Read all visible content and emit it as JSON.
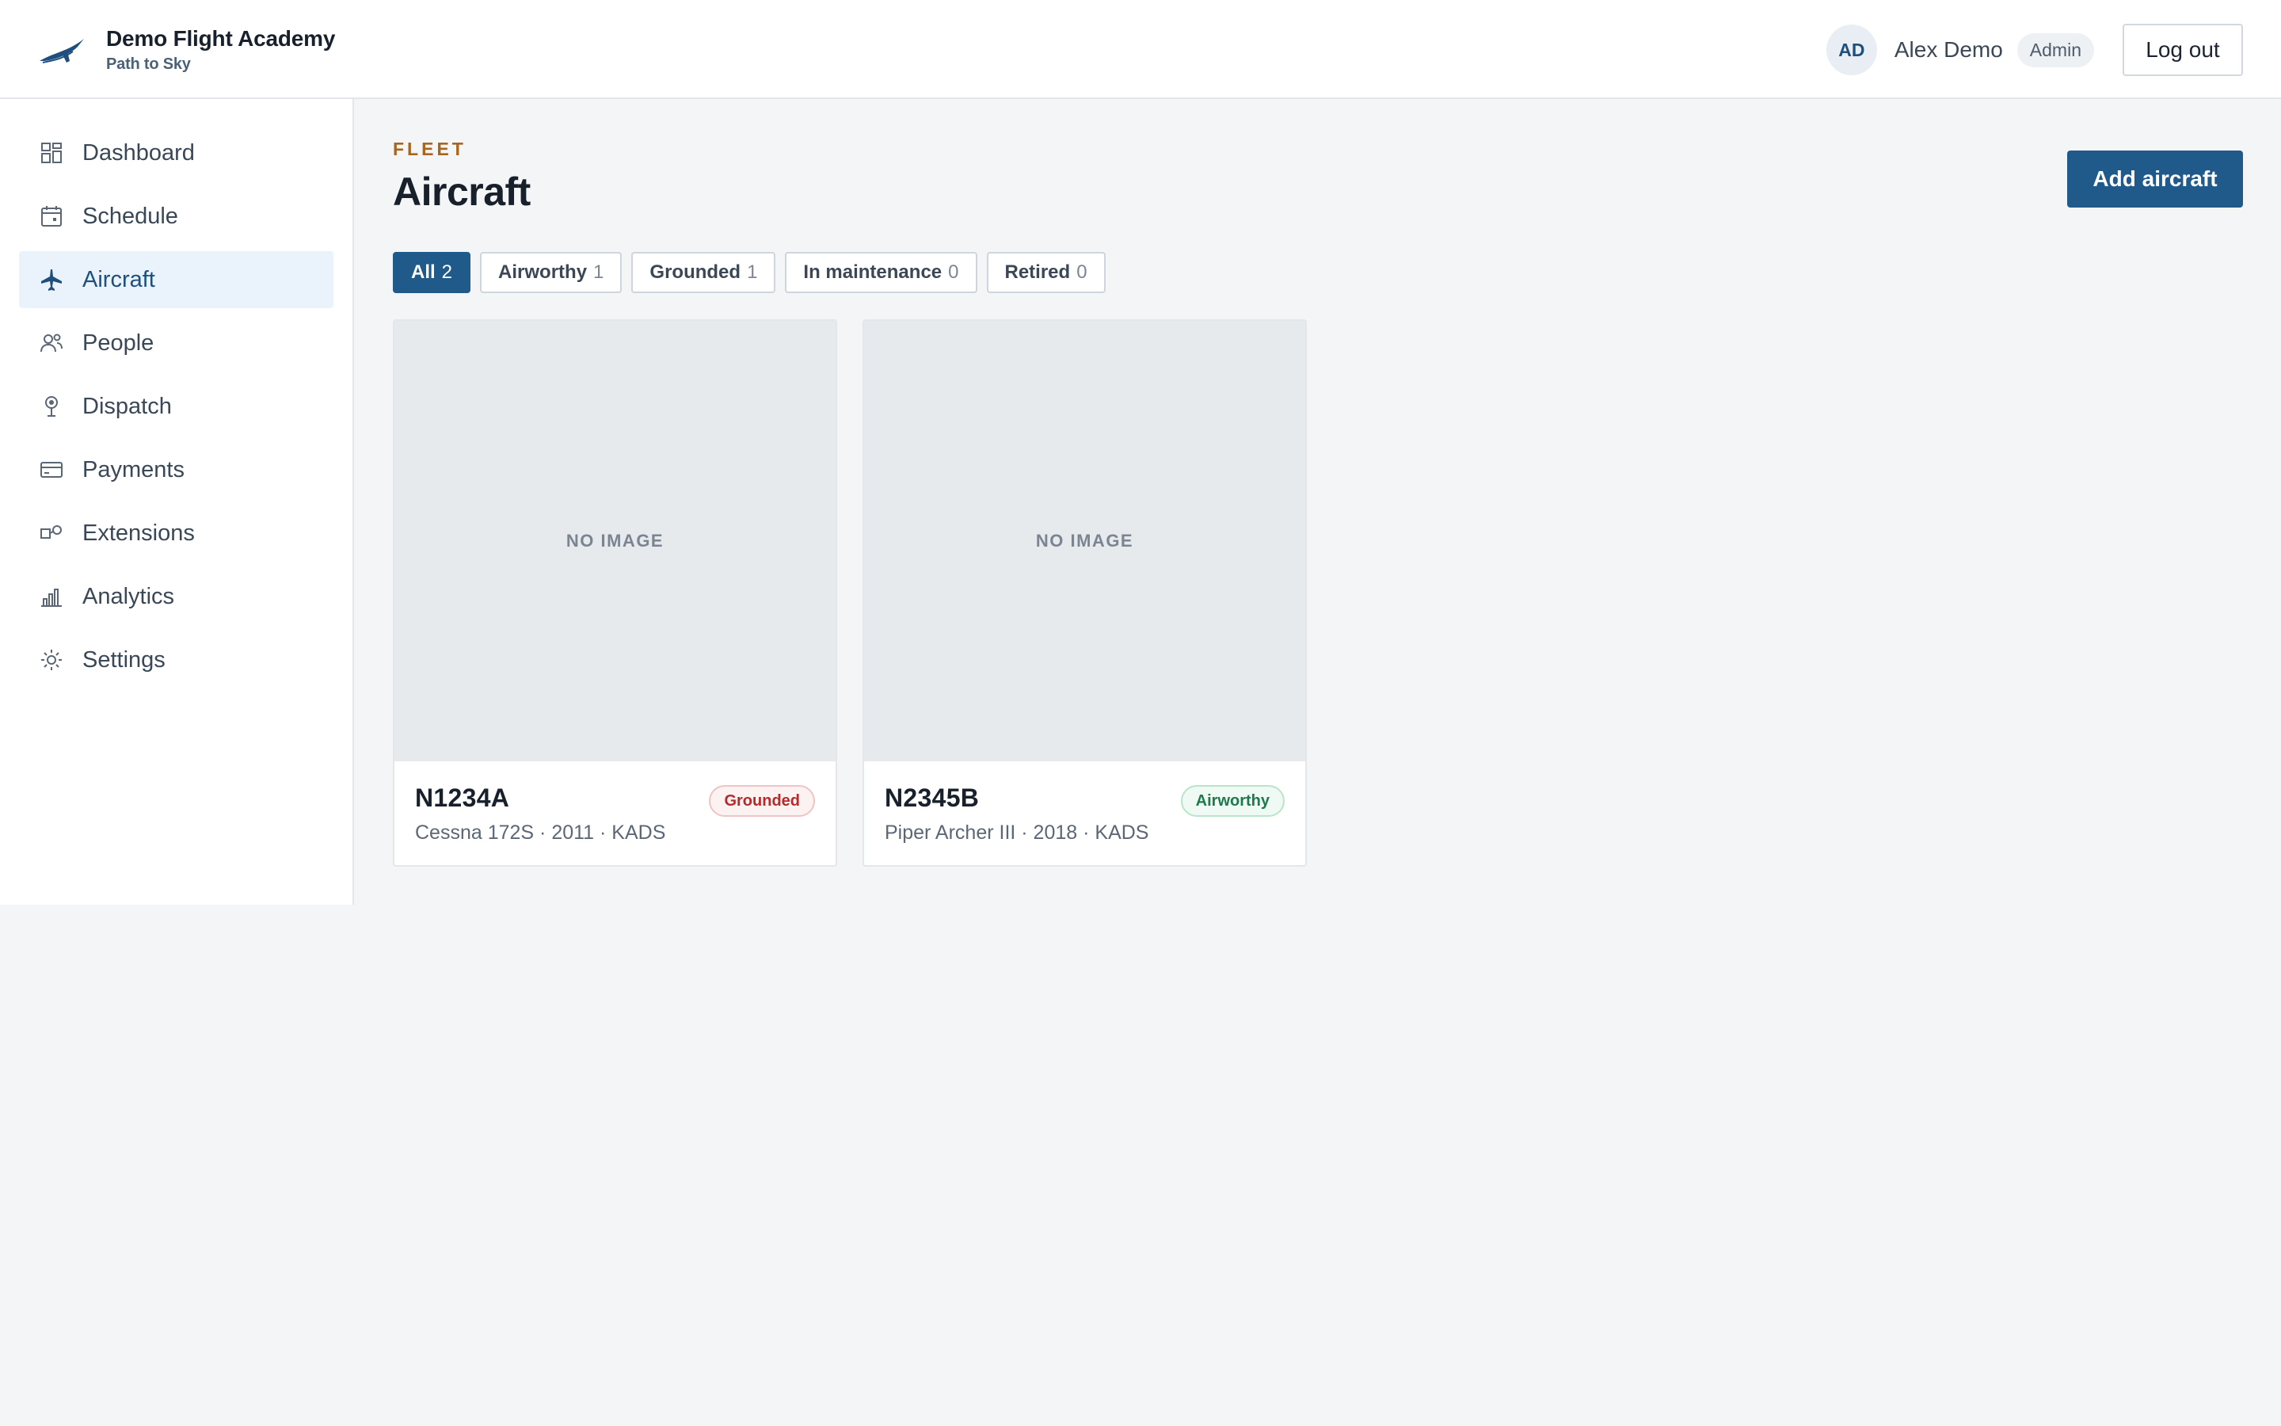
{
  "brand": {
    "name": "Demo Flight Academy",
    "tagline": "Path to Sky",
    "logo_icon": "plane-swoosh-logo"
  },
  "user": {
    "initials": "AD",
    "name": "Alex Demo",
    "role": "Admin",
    "logout_label": "Log out"
  },
  "sidebar": {
    "items": [
      {
        "label": "Dashboard",
        "icon": "dashboard-icon",
        "active": false
      },
      {
        "label": "Schedule",
        "icon": "calendar-icon",
        "active": false
      },
      {
        "label": "Aircraft",
        "icon": "airplane-icon",
        "active": true
      },
      {
        "label": "People",
        "icon": "people-icon",
        "active": false
      },
      {
        "label": "Dispatch",
        "icon": "dispatch-icon",
        "active": false
      },
      {
        "label": "Payments",
        "icon": "credit-card-icon",
        "active": false
      },
      {
        "label": "Extensions",
        "icon": "extensions-icon",
        "active": false
      },
      {
        "label": "Analytics",
        "icon": "analytics-icon",
        "active": false
      },
      {
        "label": "Settings",
        "icon": "settings-icon",
        "active": false
      }
    ]
  },
  "page": {
    "eyebrow": "FLEET",
    "title": "Aircraft",
    "add_button_label": "Add aircraft"
  },
  "filters": [
    {
      "label": "All",
      "count": "2",
      "active": true
    },
    {
      "label": "Airworthy",
      "count": "1",
      "active": false
    },
    {
      "label": "Grounded",
      "count": "1",
      "active": false
    },
    {
      "label": "In maintenance",
      "count": "0",
      "active": false
    },
    {
      "label": "Retired",
      "count": "0",
      "active": false
    }
  ],
  "aircraft": [
    {
      "tail": "N1234A",
      "image_placeholder": "NO IMAGE",
      "meta": "Cessna 172S · 2011 · KADS",
      "status": "Grounded"
    },
    {
      "tail": "N2345B",
      "image_placeholder": "NO IMAGE",
      "meta": "Piper Archer III · 2018 · KADS",
      "status": "Airworthy"
    }
  ],
  "colors": {
    "primary": "#1f5a8a",
    "accent_eyebrow": "#a8651c",
    "grounded": "#b42b2b",
    "airworthy": "#1e7a4c",
    "active_nav_bg": "#eaf3fb"
  }
}
